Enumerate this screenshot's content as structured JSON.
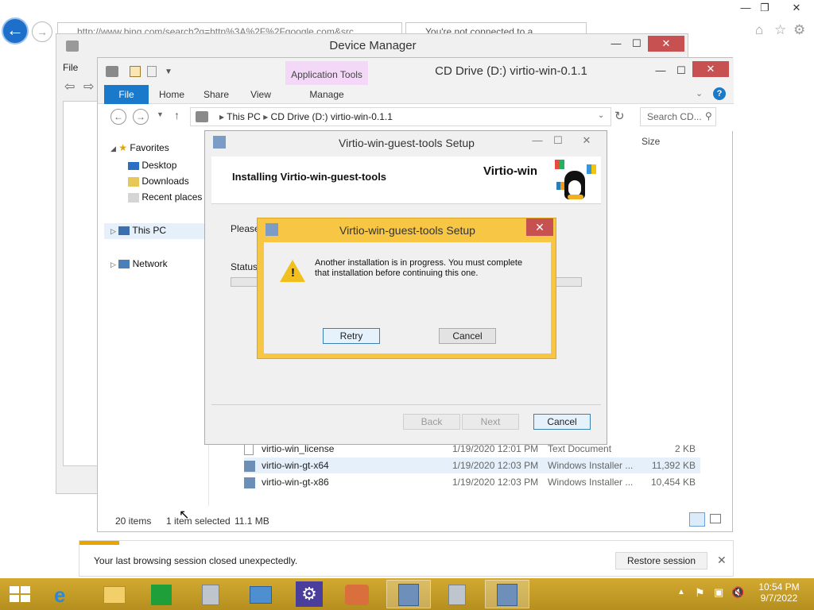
{
  "browser": {
    "address": "http://www.bing.com/search?q=http%3A%2F%2Fgoogle.com&src",
    "tab2_title": "You're not connected to a..."
  },
  "device_manager": {
    "title": "Device Manager",
    "file_menu": "File"
  },
  "explorer": {
    "title": "CD Drive (D:) virtio-win-0.1.1",
    "app_tools_label": "Application Tools",
    "ribbon_tabs": [
      "File",
      "Home",
      "Share",
      "View",
      "Manage"
    ],
    "breadcrumb": [
      "This PC",
      "CD Drive (D:) virtio-win-0.1.1"
    ],
    "search_placeholder": "Search CD...",
    "nav": {
      "favorites": "Favorites",
      "desktop": "Desktop",
      "downloads": "Downloads",
      "recent": "Recent places",
      "this_pc": "This PC",
      "network": "Network"
    },
    "column_size": "Size",
    "files": [
      {
        "name": "virtio-win_license",
        "date": "1/19/2020 12:01 PM",
        "type": "Text Document",
        "size": "2 KB"
      },
      {
        "name": "virtio-win-gt-x64",
        "date": "1/19/2020 12:03 PM",
        "type": "Windows Installer ...",
        "size": "11,392 KB"
      },
      {
        "name": "virtio-win-gt-x86",
        "date": "1/19/2020 12:03 PM",
        "type": "Windows Installer ...",
        "size": "10,454 KB"
      }
    ],
    "status": {
      "count": "20 items",
      "selected": "1 item selected",
      "size": "11.1 MB"
    }
  },
  "setup": {
    "title": "Virtio-win-guest-tools Setup",
    "heading": "Installing Virtio-win-guest-tools",
    "brand": "Virtio-win",
    "please_wait": "Please",
    "status_label": "Status:",
    "buttons": {
      "back": "Back",
      "next": "Next",
      "cancel": "Cancel"
    }
  },
  "modal": {
    "title": "Virtio-win-guest-tools Setup",
    "message_line1": "Another installation is in progress. You must complete",
    "message_line2": "that installation before continuing this one.",
    "retry": "Retry",
    "cancel": "Cancel"
  },
  "notification": {
    "message": "Your last browsing session closed unexpectedly.",
    "restore": "Restore session"
  },
  "clock": {
    "time": "10:54 PM",
    "date": "9/7/2022"
  },
  "colors": {
    "taskbar": "#c8a22a",
    "modal_frame": "#f6c644",
    "accent_blue": "#1979ca",
    "close_red": "#c75050"
  }
}
